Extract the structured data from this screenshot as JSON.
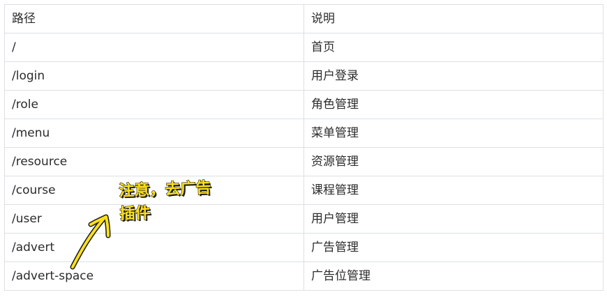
{
  "table": {
    "headers": [
      "路径",
      "说明"
    ],
    "rows": [
      {
        "path": "/",
        "desc": "首页"
      },
      {
        "path": "/login",
        "desc": "用户登录"
      },
      {
        "path": "/role",
        "desc": "角色管理"
      },
      {
        "path": "/menu",
        "desc": "菜单管理"
      },
      {
        "path": "/resource",
        "desc": "资源管理"
      },
      {
        "path": "/course",
        "desc": "课程管理"
      },
      {
        "path": "/user",
        "desc": "用户管理"
      },
      {
        "path": "/advert",
        "desc": "广告管理"
      },
      {
        "path": "/advert-space",
        "desc": "广告位管理"
      }
    ]
  },
  "annotation": {
    "line1": "注意，去广告",
    "line2": "插件",
    "color": "#ffe11a"
  }
}
